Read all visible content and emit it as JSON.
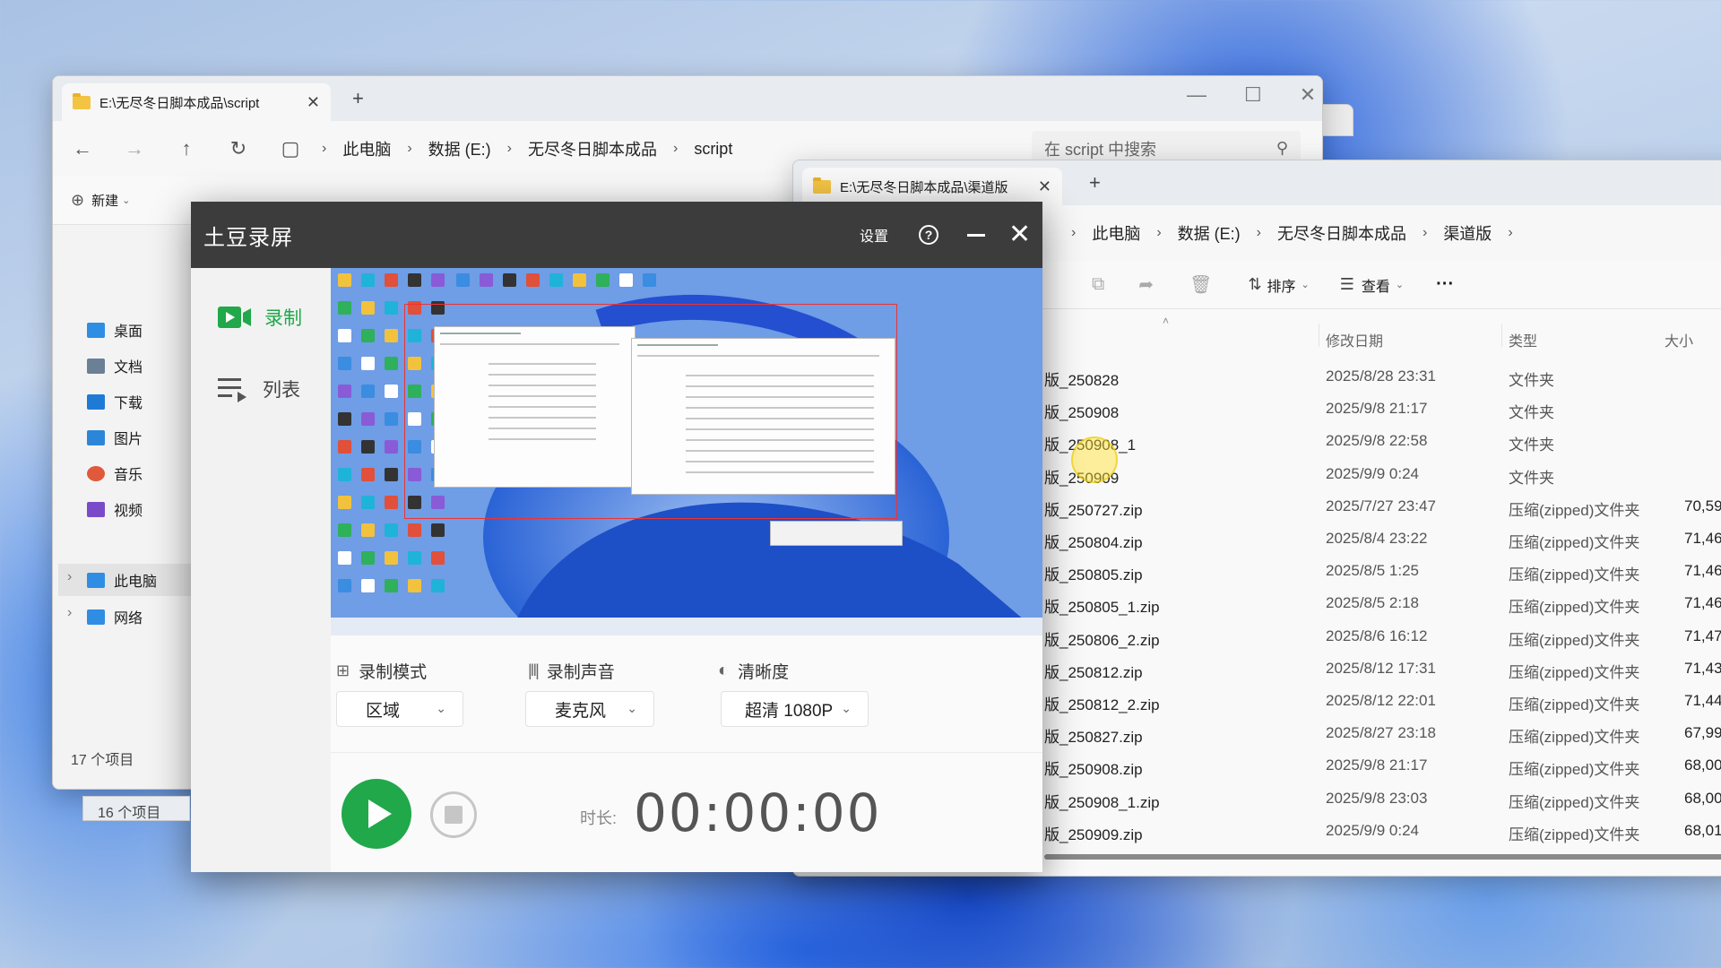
{
  "explorer_back": {
    "tab_title": "E:\\无尽冬日脚本成品\\script",
    "tab_close": "✕",
    "new_tab": "+",
    "breadcrumbs": [
      "此电脑",
      "数据 (E:)",
      "无尽冬日脚本成品",
      "script"
    ],
    "search_placeholder": "在 script 中搜索",
    "toolbar": {
      "new_label": "新建",
      "sort_label": "排序",
      "view_label": "查看"
    },
    "sidebar": [
      {
        "label": "桌面",
        "color": "#2f8de4"
      },
      {
        "label": "文档",
        "color": "#6b7f96"
      },
      {
        "label": "下载",
        "color": "#1f7ad6"
      },
      {
        "label": "图片",
        "color": "#2b86d9"
      },
      {
        "label": "音乐",
        "color": "#e0593a"
      },
      {
        "label": "视频",
        "color": "#7a4bc8"
      },
      {
        "label": "此电脑",
        "color": "#2f8de4"
      },
      {
        "label": "网络",
        "color": "#2f8de4"
      }
    ],
    "status_items": "17 个项目"
  },
  "explorer_front": {
    "tab_title": "E:\\无尽冬日脚本成品\\渠道版",
    "tab_close": "✕",
    "new_tab": "+",
    "breadcrumbs": [
      "此电脑",
      "数据 (E:)",
      "无尽冬日脚本成品",
      "渠道版"
    ],
    "toolbar": {
      "sort_label": "排序",
      "view_label": "查看",
      "more": "···"
    },
    "status_items": "16 个项目",
    "columns": {
      "date": "修改日期",
      "type": "类型",
      "size": "大小"
    },
    "files": [
      {
        "name": "版_250828",
        "date": "2025/8/28 23:31",
        "type": "文件夹",
        "size": ""
      },
      {
        "name": "版_250908",
        "date": "2025/9/8 21:17",
        "type": "文件夹",
        "size": ""
      },
      {
        "name": "版_250908_1",
        "date": "2025/9/8 22:58",
        "type": "文件夹",
        "size": ""
      },
      {
        "name": "版_250909",
        "date": "2025/9/9 0:24",
        "type": "文件夹",
        "size": ""
      },
      {
        "name": "版_250727.zip",
        "date": "2025/7/27 23:47",
        "type": "压缩(zipped)文件夹",
        "size": "70,59"
      },
      {
        "name": "版_250804.zip",
        "date": "2025/8/4 23:22",
        "type": "压缩(zipped)文件夹",
        "size": "71,46"
      },
      {
        "name": "版_250805.zip",
        "date": "2025/8/5 1:25",
        "type": "压缩(zipped)文件夹",
        "size": "71,46"
      },
      {
        "name": "版_250805_1.zip",
        "date": "2025/8/5 2:18",
        "type": "压缩(zipped)文件夹",
        "size": "71,46"
      },
      {
        "name": "版_250806_2.zip",
        "date": "2025/8/6 16:12",
        "type": "压缩(zipped)文件夹",
        "size": "71,47"
      },
      {
        "name": "版_250812.zip",
        "date": "2025/8/12 17:31",
        "type": "压缩(zipped)文件夹",
        "size": "71,43"
      },
      {
        "name": "版_250812_2.zip",
        "date": "2025/8/12 22:01",
        "type": "压缩(zipped)文件夹",
        "size": "71,44"
      },
      {
        "name": "版_250827.zip",
        "date": "2025/8/27 23:18",
        "type": "压缩(zipped)文件夹",
        "size": "67,99"
      },
      {
        "name": "版_250908.zip",
        "date": "2025/9/8 21:17",
        "type": "压缩(zipped)文件夹",
        "size": "68,00"
      },
      {
        "name": "版_250908_1.zip",
        "date": "2025/9/8 23:03",
        "type": "压缩(zipped)文件夹",
        "size": "68,00"
      },
      {
        "name": "版_250909.zip",
        "date": "2025/9/9 0:24",
        "type": "压缩(zipped)文件夹",
        "size": "68,01"
      }
    ]
  },
  "recorder": {
    "title": "土豆录屏",
    "settings": "设置",
    "help": "?",
    "nav": {
      "record": "录制",
      "list": "列表"
    },
    "accent": "#20a84a",
    "mode": {
      "label": "录制模式",
      "value": "区域"
    },
    "audio": {
      "label": "录制声音",
      "value": "麦克风"
    },
    "quality": {
      "label": "清晰度",
      "value": "超清 1080P"
    },
    "duration_label": "时长:",
    "duration": "00:00:00"
  }
}
